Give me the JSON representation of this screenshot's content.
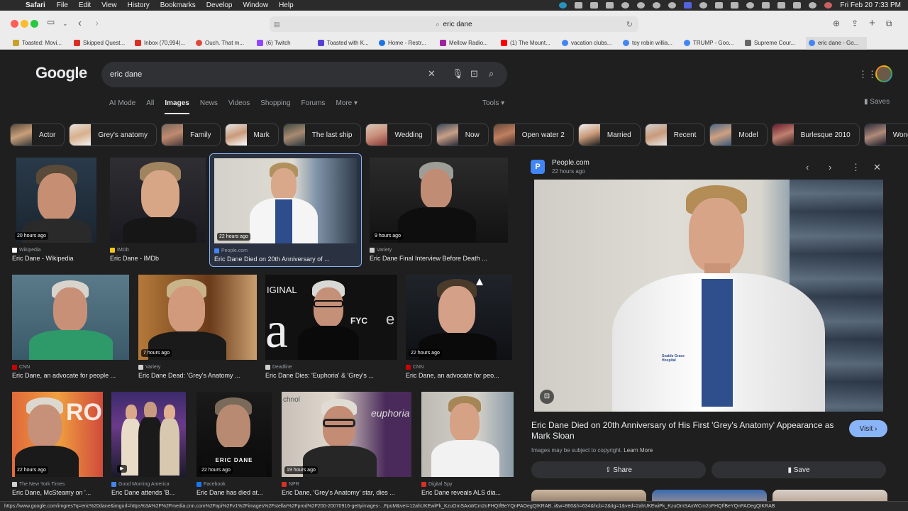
{
  "menubar": {
    "app": "Safari",
    "items": [
      "File",
      "Edit",
      "View",
      "History",
      "Bookmarks",
      "Develop",
      "Window",
      "Help"
    ],
    "clock": "Fri Feb 20  7:33 PM"
  },
  "browser": {
    "url": "eric dane"
  },
  "bookmarks": [
    {
      "label": "Toasted: Movi...",
      "color": "#c9a227"
    },
    {
      "label": "Skipped Quest...",
      "color": "#d93025"
    },
    {
      "label": "Inbox (70,994)...",
      "color": "#d93025"
    },
    {
      "label": "Ouch. That m...",
      "color": "#e0483e"
    },
    {
      "label": "(6) Twitch",
      "color": "#9146ff"
    },
    {
      "label": "Toasted with K...",
      "color": "#5a3fd6"
    },
    {
      "label": "Home - Restr...",
      "color": "#1a73e8"
    },
    {
      "label": "Mellow Radio...",
      "color": "#a020a0"
    },
    {
      "label": "(1) The Mount...",
      "color": "#ff0000"
    },
    {
      "label": "vacation clubs...",
      "color": "#4285f4"
    },
    {
      "label": "toy robin willia...",
      "color": "#4285f4"
    },
    {
      "label": "TRUMP - Goo...",
      "color": "#4285f4"
    },
    {
      "label": "Supreme Cour...",
      "color": "#666666"
    },
    {
      "label": "eric dane - Go...",
      "color": "#4285f4"
    }
  ],
  "google": {
    "logo": "Google",
    "query": "eric dane",
    "tabs": [
      "AI Mode",
      "All",
      "Images",
      "News",
      "Videos",
      "Shopping",
      "Forums",
      "More"
    ],
    "active_tab": "Images",
    "tools": "Tools",
    "saves": "Saves"
  },
  "chips": [
    "Actor",
    "Grey's anatomy",
    "Family",
    "Mark",
    "The last ship",
    "Wedding",
    "Now",
    "Open water 2",
    "Married",
    "Recent",
    "Model",
    "Burlesque 2010",
    "Wonder year"
  ],
  "results": [
    {
      "time": "20 hours ago",
      "source": "Wikipedia",
      "caption": "Eric Dane - Wikipedia",
      "fav": "#ffffff"
    },
    {
      "time": "",
      "source": "IMDb",
      "caption": "Eric Dane - IMDb",
      "fav": "#f5c518"
    },
    {
      "time": "22 hours ago",
      "source": "People.com",
      "caption": "Eric Dane Died on 20th Anniversary of ...",
      "fav": "#4285f4"
    },
    {
      "time": "9 hours ago",
      "source": "Variety",
      "caption": "Eric Dane Final Interview Before Death ...",
      "fav": "#cfcfcf"
    },
    {
      "time": "",
      "source": "CNN",
      "caption": "Eric Dane, an advocate for people ...",
      "fav": "#cc0000"
    },
    {
      "time": "7 hours ago",
      "source": "Variety",
      "caption": "Eric Dane Dead: 'Grey's Anatomy ...",
      "fav": "#cfcfcf"
    },
    {
      "time": "",
      "source": "Deadline",
      "caption": "Eric Dane Dies: 'Euphoria' & 'Grey's ...",
      "fav": "#cfcfcf"
    },
    {
      "time": "22 hours ago",
      "source": "CNN",
      "caption": "Eric Dane, an advocate for peo...",
      "fav": "#cc0000"
    },
    {
      "time": "22 hours ago",
      "source": "The New York Times",
      "caption": "Eric Dane, McSteamy on '...",
      "fav": "#cfcfcf"
    },
    {
      "time": "",
      "source": "Good Morning America",
      "caption": "Eric Dane attends 'B...",
      "fav": "#4285f4"
    },
    {
      "time": "22 hours ago",
      "source": "Facebook",
      "caption": "Eric Dane has died at...",
      "fav": "#1877f2"
    },
    {
      "time": "19 hours ago",
      "source": "NPR",
      "caption": "Eric Dane, 'Grey's Anatomy' star, dies ...",
      "fav": "#d93025"
    },
    {
      "time": "",
      "source": "Digital Spy",
      "caption": "Eric Dane reveals ALS dia...",
      "fav": "#d93025"
    }
  ],
  "tile_texts": {
    "ginal": "IGINAL",
    "a_letter": "a",
    "fyc": "FYC",
    "e_letter": "e",
    "eric_dane_card": "ERIC DANE",
    "euphoria": "euphoria",
    "ross": "ROSS",
    "chnol": "chnol"
  },
  "preview": {
    "fav_letter": "P",
    "site": "People.com",
    "time": "22 hours ago",
    "title": "Eric Dane Died on 20th Anniversary of His First 'Grey's Anatomy' Appearance as Mark Sloan",
    "visit": "Visit",
    "copyright": "Images may be subject to copyright.",
    "learn_more": "Learn More",
    "share": "Share",
    "save": "Save",
    "coat_text": "Seattle Grace Hospital"
  },
  "status_url": "https://www.google.com/imgres?q=eric%20dane&imgurl=https%3A%2F%2Fmedia.cnn.com%2Fapi%2Fv1%2Fimages%2Fstellar%2Fprod%2F200-20070916-gettyimages-...FpoM&vet=12ahUKEwiPk_KzuOmSAxWCm2oFHQIfBeYQnPAOegQIKRAB..i&w=860&h=634&hcb=2&itg=1&ved=2ahUKEwiPk_KzuOmSAxWCm2oFHQIfBeYQnPAOegQIKRAB"
}
